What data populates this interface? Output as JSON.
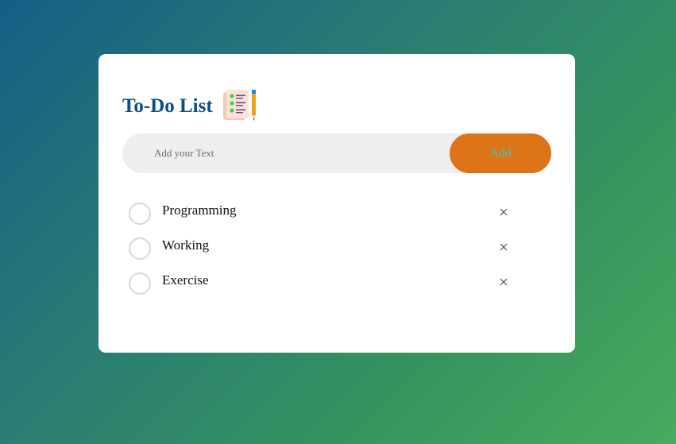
{
  "app": {
    "title": "To-Do List",
    "title_icon": "notepad-pencil-icon"
  },
  "input": {
    "placeholder": "Add your Text",
    "value": ""
  },
  "add_button": {
    "label": "Add"
  },
  "tasks": [
    {
      "label": "Programming",
      "checked": false,
      "delete_icon": "close-icon"
    },
    {
      "label": "Working",
      "checked": false,
      "delete_icon": "close-icon"
    },
    {
      "label": "Exercise",
      "checked": false,
      "delete_icon": "close-icon"
    }
  ],
  "colors": {
    "title": "#0e4f82",
    "button_bg": "#dd7417",
    "button_text": "#40c4b4",
    "input_bg": "#edeef0",
    "gradient_start": "#155e85",
    "gradient_end": "#48ab5e"
  }
}
